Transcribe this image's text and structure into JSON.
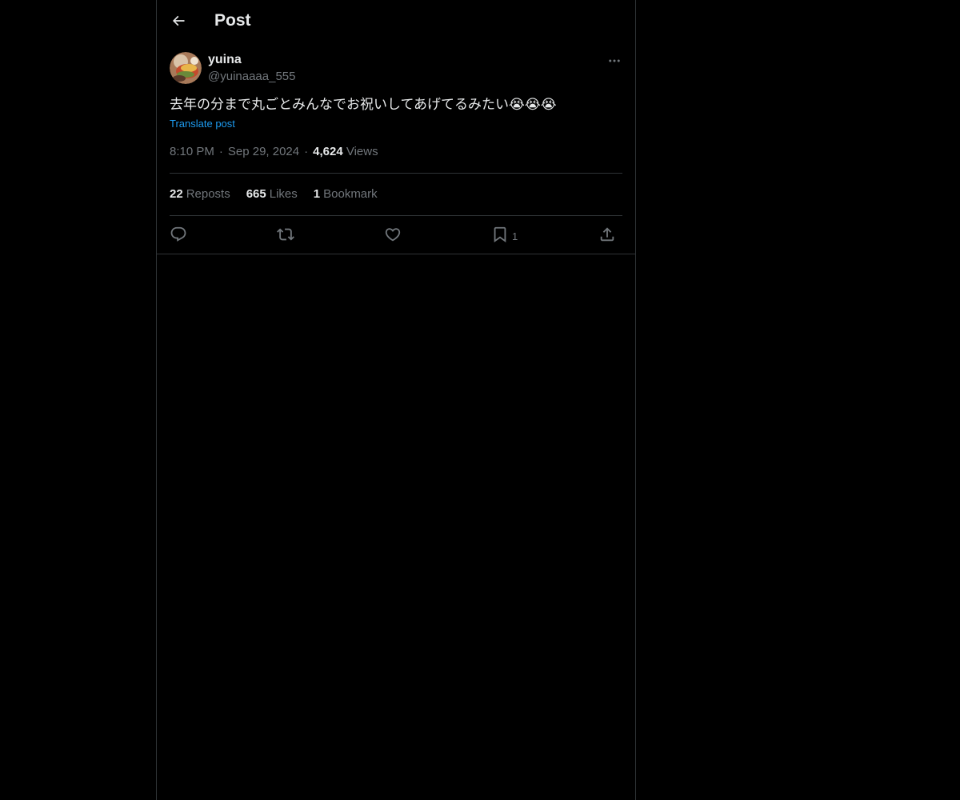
{
  "header": {
    "title": "Post",
    "back_icon": "arrow-left-icon"
  },
  "post": {
    "author": {
      "name": "yuina",
      "handle": "@yuinaaaa_555"
    },
    "text": "去年の分まで丸ごとみんなでお祝いしてあげてるみたい",
    "emojis": "😭😭😭",
    "translate_label": "Translate post",
    "time": "8:10 PM",
    "date": "Sep 29, 2024",
    "views_count": "4,624",
    "views_label": "Views",
    "separator": "·"
  },
  "stats": {
    "reposts_count": "22",
    "reposts_label": "Reposts",
    "likes_count": "665",
    "likes_label": "Likes",
    "bookmarks_count": "1",
    "bookmarks_label": "Bookmark"
  },
  "actions": {
    "reply_icon": "reply-icon",
    "repost_icon": "repost-icon",
    "like_icon": "heart-icon",
    "bookmark_icon": "bookmark-icon",
    "bookmark_count": "1",
    "share_icon": "share-icon"
  },
  "colors": {
    "background": "#000000",
    "text_primary": "#e7e9ea",
    "text_secondary": "#71767b",
    "link": "#1d9bf0",
    "border": "#2f3336"
  }
}
